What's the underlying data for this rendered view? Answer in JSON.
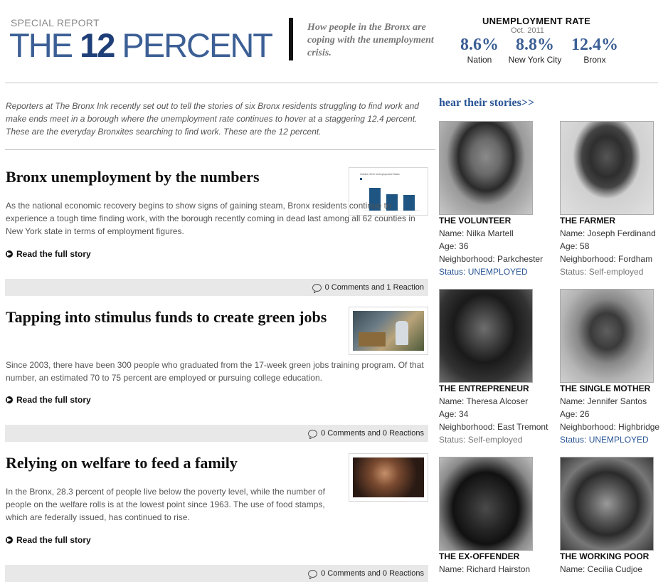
{
  "header": {
    "kicker": "SPECIAL REPORT",
    "title_pre": "THE ",
    "title_num": "12",
    "title_post": " PERCENT",
    "tagline": "How people in the Bronx are coping with the unemployment crisis."
  },
  "unemployment": {
    "label": "UNEMPLOYMENT RATE",
    "date": "Oct. 2011",
    "rates": [
      {
        "value": "8.6%",
        "name": "Nation"
      },
      {
        "value": "8.8%",
        "name": "New York City"
      },
      {
        "value": "12.4%",
        "name": "Bronx"
      }
    ]
  },
  "intro": "Reporters at The Bronx Ink recently set out to tell the stories of six Bronx residents struggling to find work and make ends meet in a borough where the unemployment rate continues to hover at a staggering 12.4 percent. These are the everyday Bronxites searching to find work. These are the 12 percent.",
  "articles": [
    {
      "title": "Bronx unemployment by the numbers",
      "body": "As the national economic recovery begins to show signs of gaining steam, Bronx residents continue to experience a tough time finding work, with the borough recently coming in dead last among all 62 counties in New York state in terms of employment figures.",
      "read_more": "Read the full story",
      "comments": "0 Comments and 1 Reaction",
      "thumb_chart_title": "October 2011 Unemployment Rates"
    },
    {
      "title": "Tapping into stimulus funds to create green jobs",
      "body": "Since 2003, there have been 300 people who graduated from the 17-week green jobs training program. Of that number, an estimated 70 to 75 percent are employed or pursuing college education.",
      "read_more": "Read the full story",
      "comments": "0 Comments and 0 Reactions"
    },
    {
      "title": "Relying on welfare to feed a family",
      "body": "In the Bronx, 28.3 percent of people live below the poverty level, while the number of people on the welfare rolls is at the lowest point since 1963. The use of food stamps, which are federally issued, has continued to rise.",
      "read_more": "Read the full story",
      "comments": "0 Comments and 0 Reactions"
    }
  ],
  "stories": {
    "heading": "hear their stories>>",
    "people": [
      {
        "role": "THE VOLUNTEER",
        "name": "Name: Nilka Martell",
        "age": "Age: 36",
        "hood": "Neighborhood: Parkchester",
        "status": "Status: UNEMPLOYED",
        "status_type": "unemployed"
      },
      {
        "role": "THE FARMER",
        "name": "Name: Joseph Ferdinand",
        "age": "Age: 58",
        "hood": "Neighborhood: Fordham",
        "status": "Status: Self-employed",
        "status_type": "self"
      },
      {
        "role": "THE ENTREPRENEUR",
        "name": "Name: Theresa Alcoser",
        "age": "Age: 34",
        "hood": "Neighborhood: East Tremont",
        "status": "Status: Self-employed",
        "status_type": "self"
      },
      {
        "role": "THE SINGLE MOTHER",
        "name": "Name: Jennifer Santos",
        "age": "Age: 26",
        "hood": "Neighborhood: Highbridge",
        "status": "Status: UNEMPLOYED",
        "status_type": "unemployed"
      },
      {
        "role": "THE EX-OFFENDER",
        "name": "Name: Richard Hairston",
        "age": "",
        "hood": "",
        "status": "",
        "status_type": ""
      },
      {
        "role": "THE WORKING POOR",
        "name": "Name: Cecilia Cudjoe",
        "age": "",
        "hood": "",
        "status": "",
        "status_type": ""
      }
    ]
  },
  "colors": {
    "accent": "#3c5f95",
    "accent_dark": "#1f3f78",
    "link": "#2a5696"
  }
}
